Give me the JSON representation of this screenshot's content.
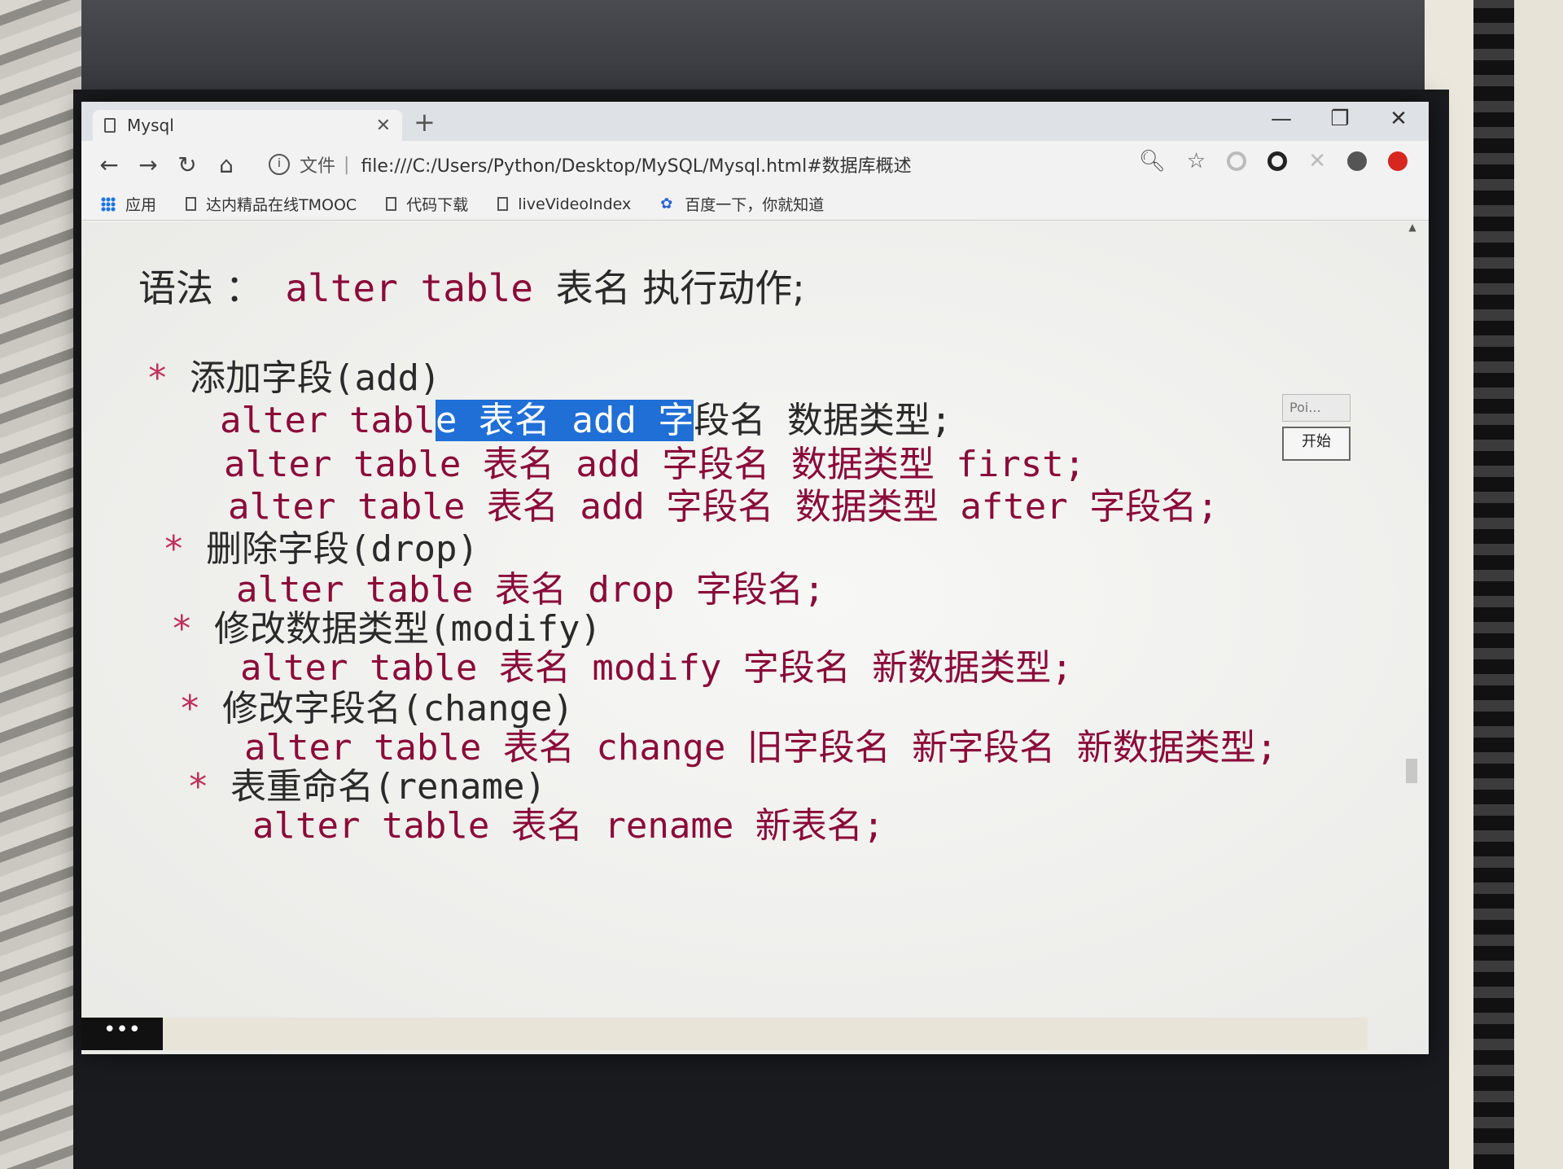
{
  "tab": {
    "title": "Mysql"
  },
  "address_bar": {
    "scheme_label": "文件",
    "url": "file:///C:/Users/Python/Desktop/MySQL/Mysql.html#数据库概述"
  },
  "bookmarks": [
    {
      "label": "应用",
      "icon": "apps-icon"
    },
    {
      "label": "达内精品在线TMOOC",
      "icon": "doc-icon"
    },
    {
      "label": "代码下载",
      "icon": "doc-icon"
    },
    {
      "label": "liveVideoIndex",
      "icon": "doc-icon"
    },
    {
      "label": "百度一下，你就知道",
      "icon": "paw-icon"
    }
  ],
  "content": {
    "syntax": {
      "prefix": "语法 ：",
      "keyword": "alter table",
      "rest": "表名 执行动作;"
    },
    "sections": [
      {
        "heading": "添加字段(add)"
      },
      {
        "heading": "删除字段(drop)"
      },
      {
        "heading": "修改数据类型(modify)"
      },
      {
        "heading": "修改字段名(change)"
      },
      {
        "heading": "表重命名(rename)"
      }
    ],
    "code": {
      "add_1_pre": "alter tabl",
      "add_1_hl": "e 表名 add 字",
      "add_1_post": "段名 数据类型;",
      "add_2": "alter table 表名 add 字段名 数据类型 first;",
      "add_3": "alter table 表名 add 字段名 数据类型 after 字段名;",
      "drop": "alter table 表名 drop 字段名;",
      "modify": "alter table 表名 modify 字段名 新数据类型;",
      "change": "alter table 表名 change 旧字段名 新字段名 新数据类型;",
      "rename": "alter table 表名 rename 新表名;"
    },
    "star": "*"
  },
  "float_panel": {
    "field_text": "Poi...",
    "start_label": "开始"
  },
  "taskbar": {
    "dots": "•••"
  },
  "colors": {
    "highlight": "#1f6fd6",
    "keyword": "#8b0a3a",
    "star": "#c0305c"
  }
}
